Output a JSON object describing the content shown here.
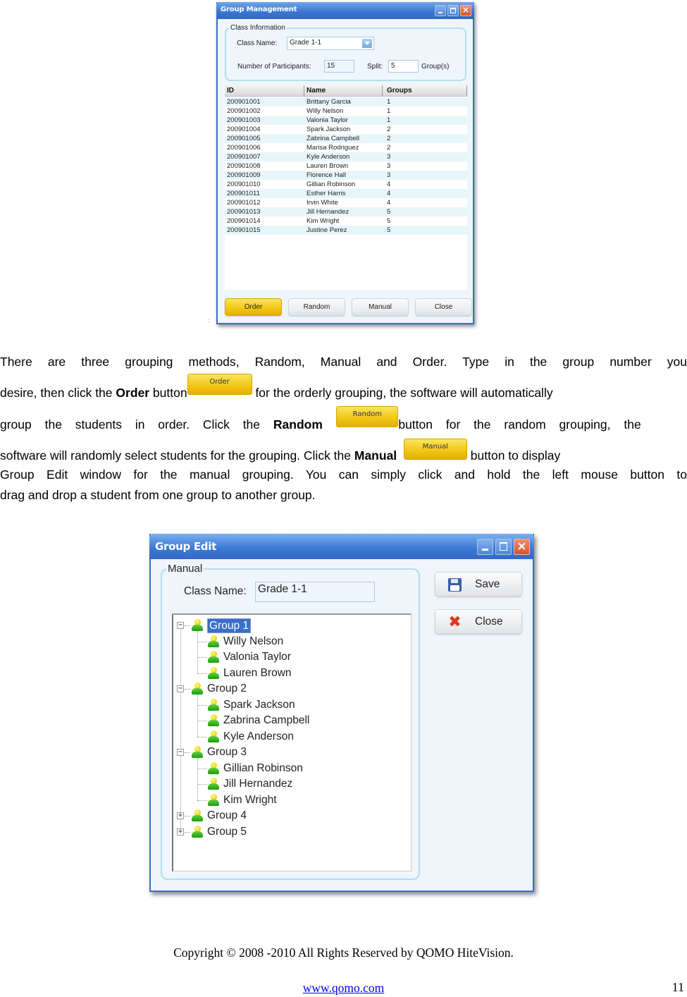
{
  "group_management": {
    "title": "Group Management",
    "class_info_legend": "Class Information",
    "class_name_label": "Class Name:",
    "class_name_value": "Grade 1-1",
    "participants_label": "Number of Participants:",
    "participants_value": "15",
    "split_label": "Split:",
    "split_value": "5",
    "split_unit": "Group(s)",
    "columns": [
      "ID",
      "Name",
      "Groups"
    ],
    "rows": [
      {
        "id": "200901001",
        "name": "Brittany Garcia",
        "group": "1"
      },
      {
        "id": "200901002",
        "name": "Willy Nelson",
        "group": "1"
      },
      {
        "id": "200901003",
        "name": "Valonia Taylor",
        "group": "1"
      },
      {
        "id": "200901004",
        "name": "Spark Jackson",
        "group": "2"
      },
      {
        "id": "200901005",
        "name": "Zabrina Campbell",
        "group": "2"
      },
      {
        "id": "200901006",
        "name": "Marisa Rodriguez",
        "group": "2"
      },
      {
        "id": "200901007",
        "name": "Kyle Anderson",
        "group": "3"
      },
      {
        "id": "200901008",
        "name": "Lauren Brown",
        "group": "3"
      },
      {
        "id": "200901009",
        "name": "Florence Hall",
        "group": "3"
      },
      {
        "id": "200901010",
        "name": "Gillian Robinson",
        "group": "4"
      },
      {
        "id": "200901011",
        "name": "Esther Harris",
        "group": "4"
      },
      {
        "id": "200901012",
        "name": "Irvin White",
        "group": "4"
      },
      {
        "id": "200901013",
        "name": "Jill  Hernandez",
        "group": "5"
      },
      {
        "id": "200901014",
        "name": "Kim Wright",
        "group": "5"
      },
      {
        "id": "200901015",
        "name": "Justine Perez",
        "group": "5"
      }
    ],
    "buttons": {
      "order": "Order",
      "random": "Random",
      "manual": "Manual",
      "close": "Close"
    },
    "stray_mark": ":"
  },
  "paragraph": {
    "line1": "There are three grouping methods, Random, Manual and Order. Type in the group number you",
    "line2_a": "desire, then click the ",
    "line2_bold": "Order",
    "line2_b": " button",
    "line2_btn": "Order",
    "line2_c": " for the orderly grouping, the software will automatically",
    "line3_a": "group the students in order. Click the ",
    "line3_bold": "Random",
    "line3_btn": "Random",
    "line3_c": "button for the random grouping, the",
    "line4_a": "software will randomly select students for the grouping. Click the ",
    "line4_bold": "Manual",
    "line4_btn": "Manual",
    "line4_c": " button to display",
    "line5": "Group Edit window for the manual grouping. You can simply click and hold the left mouse button to",
    "line6": "drag and drop a student from one group to another group."
  },
  "group_edit": {
    "title": "Group Edit",
    "legend": "Manual",
    "class_name_label": "Class Name:",
    "class_name_value": "Grade 1-1",
    "save_label": "Save",
    "close_label": "Close",
    "tree": [
      {
        "label": "Group 1",
        "expanded": true,
        "selected": true,
        "members": [
          "Willy Nelson",
          "Valonia Taylor",
          "Lauren Brown"
        ]
      },
      {
        "label": "Group 2",
        "expanded": true,
        "selected": false,
        "members": [
          "Spark Jackson",
          "Zabrina Campbell",
          "Kyle Anderson"
        ]
      },
      {
        "label": "Group 3",
        "expanded": true,
        "selected": false,
        "members": [
          "Gillian Robinson",
          "Jill  Hernandez",
          "Kim Wright"
        ]
      },
      {
        "label": "Group 4",
        "expanded": false,
        "selected": false,
        "members": []
      },
      {
        "label": "Group 5",
        "expanded": false,
        "selected": false,
        "members": []
      }
    ]
  },
  "footer": {
    "copyright": "Copyright © 2008 -2010 All Rights Reserved by QOMO HiteVision.",
    "link": "www.qomo.com",
    "page_number": "11"
  }
}
